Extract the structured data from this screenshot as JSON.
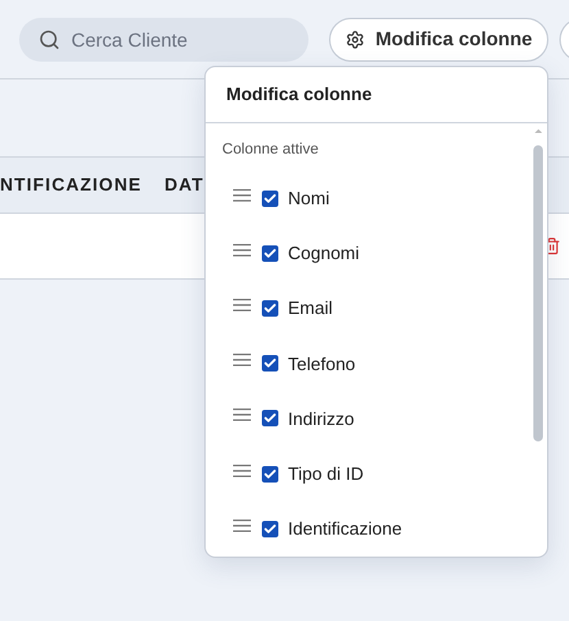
{
  "search": {
    "placeholder": "Cerca Cliente"
  },
  "edit_columns_button": {
    "label": "Modifica colonne"
  },
  "table": {
    "columns": [
      "NTIFICAZIONE",
      "DAT"
    ]
  },
  "popover": {
    "title": "Modifica colonne",
    "section": "Colonne attive",
    "items": [
      {
        "label": "Nomi",
        "checked": true
      },
      {
        "label": "Cognomi",
        "checked": true
      },
      {
        "label": "Email",
        "checked": true
      },
      {
        "label": "Telefono",
        "checked": true
      },
      {
        "label": "Indirizzo",
        "checked": true
      },
      {
        "label": "Tipo di ID",
        "checked": true
      },
      {
        "label": "Identificazione",
        "checked": true
      }
    ]
  }
}
